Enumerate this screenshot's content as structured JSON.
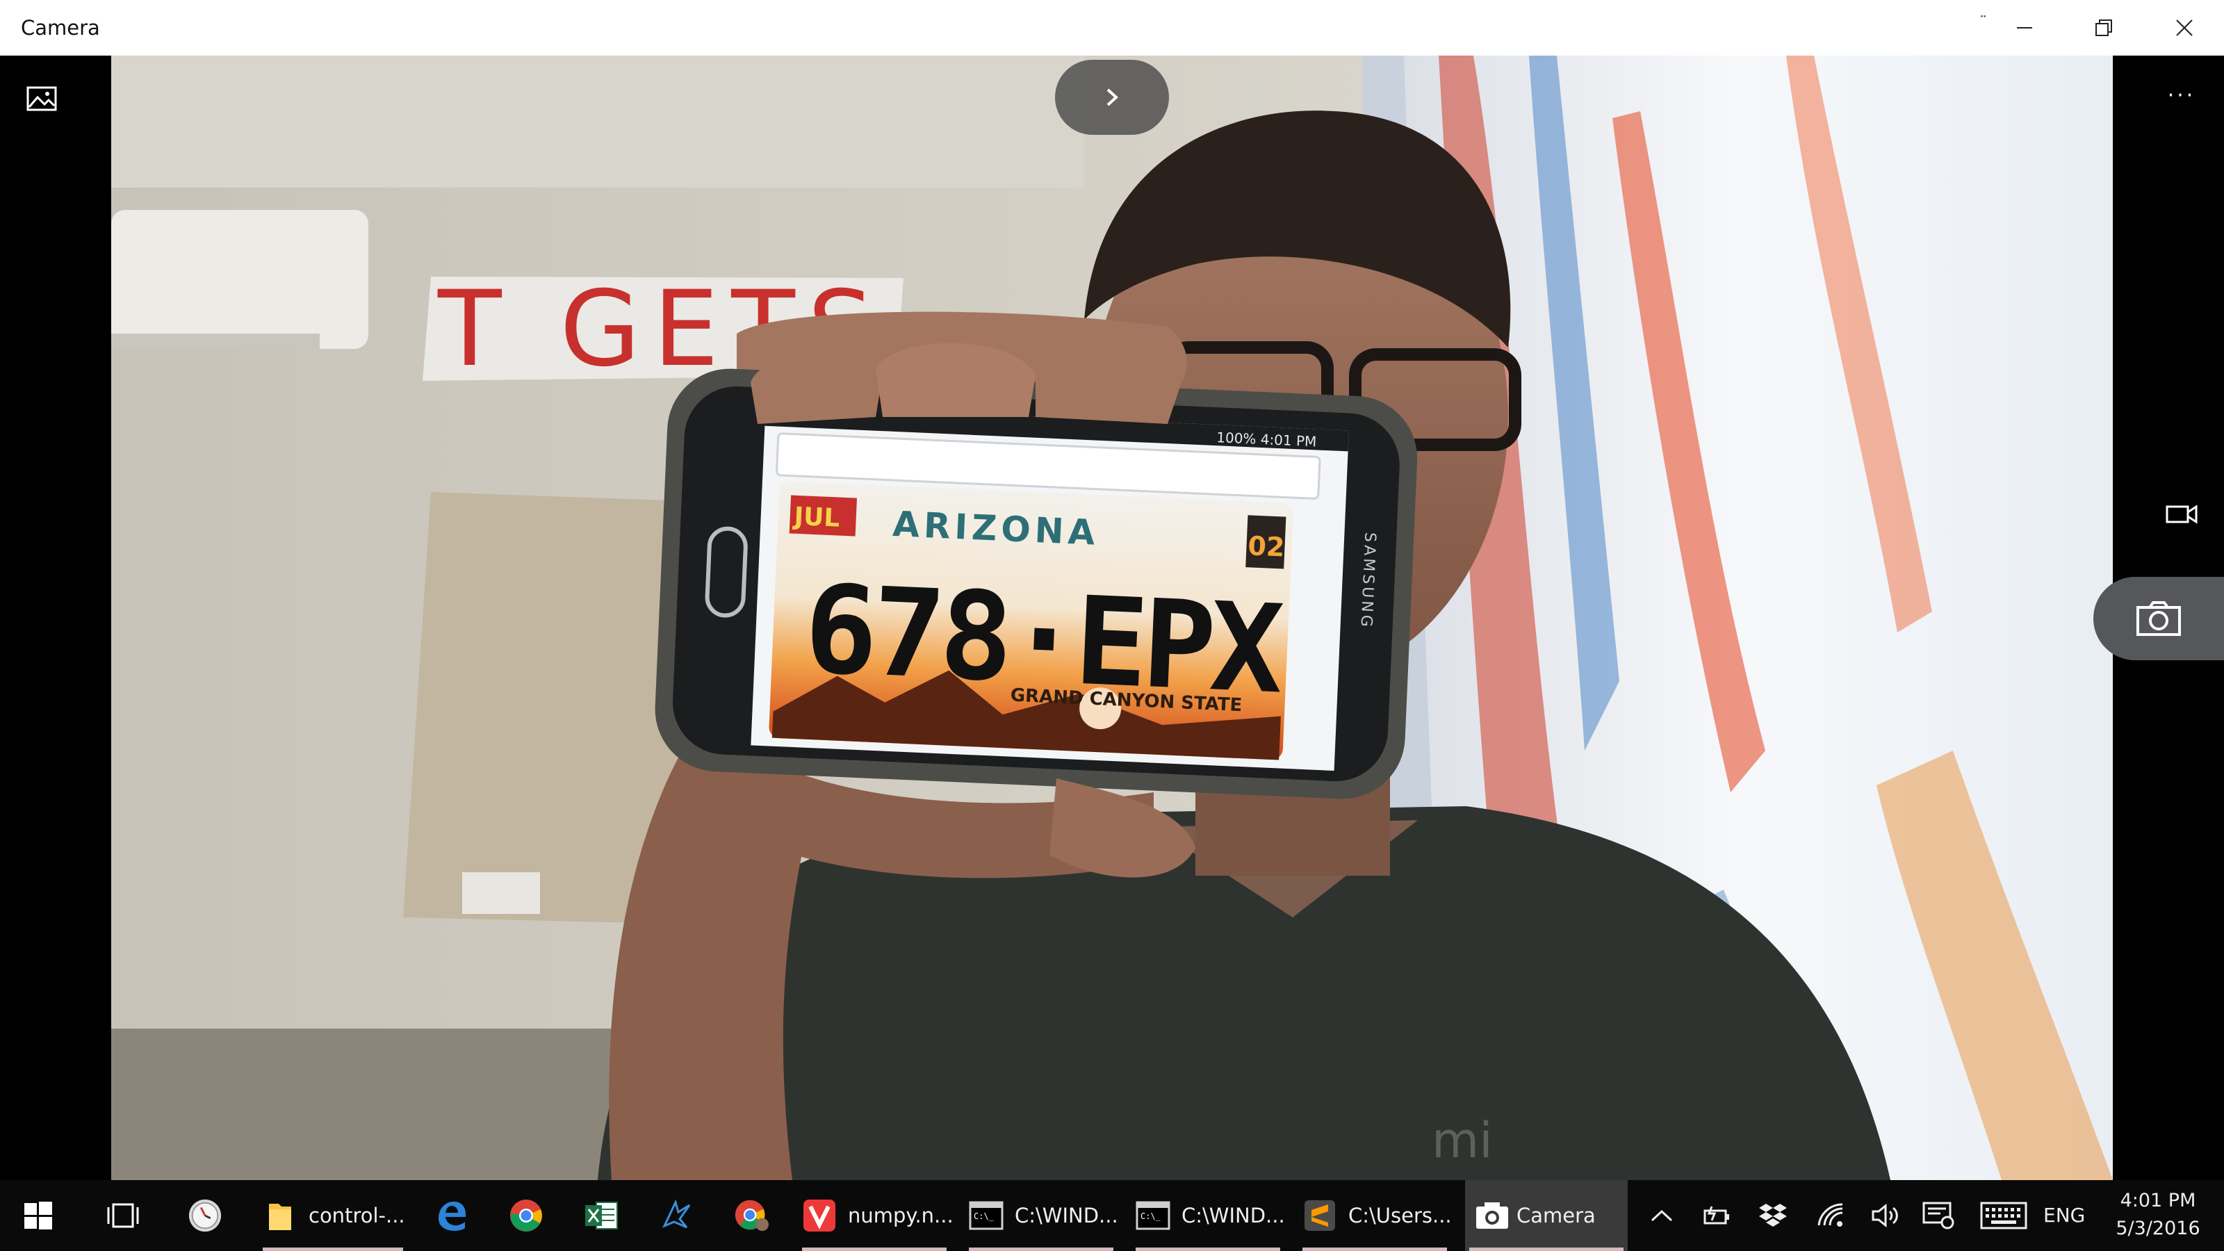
{
  "window": {
    "title": "Camera",
    "compact_dots": "¨"
  },
  "camera": {
    "more_label": "···",
    "scene": {
      "banner_text": "T GETS",
      "plate_state": "ARIZONA",
      "plate_month": "JUL",
      "plate_year": "02",
      "plate_number": "678·EPX",
      "plate_slogan": "GRAND CANYON STATE",
      "phone_brand": "SAMSUNG",
      "phone_status": "100% 4:01 PM",
      "shirt_logo": "mi"
    },
    "icons": [
      "gallery-icon",
      "chevron-right-icon",
      "more-icon",
      "video-camera-icon",
      "camera-icon"
    ]
  },
  "taskbar": {
    "items": [
      {
        "name": "start",
        "label": ""
      },
      {
        "name": "task-view",
        "label": ""
      },
      {
        "name": "clock-app",
        "label": ""
      },
      {
        "name": "file-explorer",
        "label": "control-..."
      },
      {
        "name": "edge",
        "label": ""
      },
      {
        "name": "chrome",
        "label": ""
      },
      {
        "name": "excel",
        "label": ""
      },
      {
        "name": "app-blue",
        "label": ""
      },
      {
        "name": "chrome-profile",
        "label": ""
      },
      {
        "name": "vivaldi",
        "label": "numpy.n..."
      },
      {
        "name": "cmd-1",
        "label": "C:\\WIND..."
      },
      {
        "name": "cmd-2",
        "label": "C:\\WIND..."
      },
      {
        "name": "sublime",
        "label": "C:\\Users..."
      },
      {
        "name": "camera",
        "label": "Camera"
      }
    ],
    "tray": {
      "language": "ENG",
      "time": "4:01 PM",
      "date": "5/3/2016"
    }
  }
}
